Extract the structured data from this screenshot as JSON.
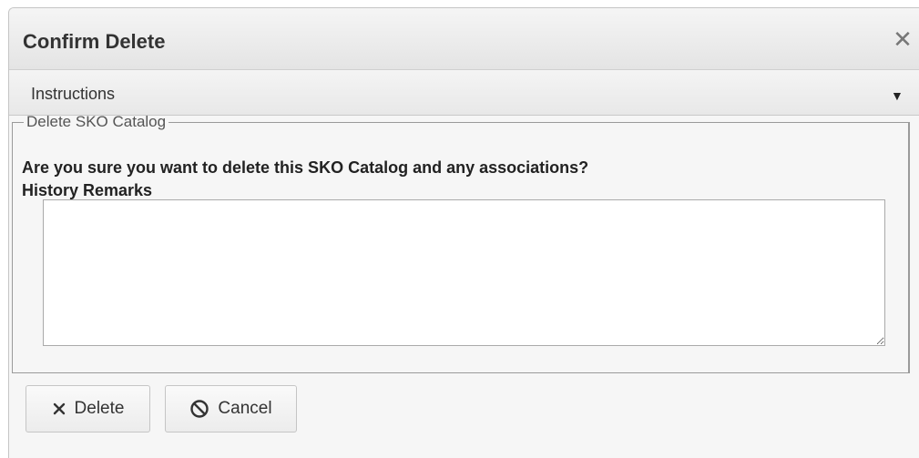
{
  "dialog": {
    "title": "Confirm Delete",
    "close_glyph": "✕",
    "close_icon": "close-icon"
  },
  "instructions": {
    "label": "Instructions",
    "caret_glyph": "▼",
    "caret_icon": "caret-down-icon",
    "expanded": false
  },
  "form": {
    "legend": "Delete SKO Catalog",
    "question": "Are you sure you want to delete this SKO Catalog and any associations?",
    "remarks_label": "History Remarks",
    "remarks_value": ""
  },
  "buttons": {
    "delete_label": "Delete",
    "delete_icon": "x-icon",
    "cancel_label": "Cancel",
    "cancel_icon": "prohibited-icon"
  },
  "colors": {
    "dialog_background": "#f6f6f6",
    "titlebar_background": "#e8e8e8",
    "border": "#c5c5c5",
    "text": "#222222"
  }
}
